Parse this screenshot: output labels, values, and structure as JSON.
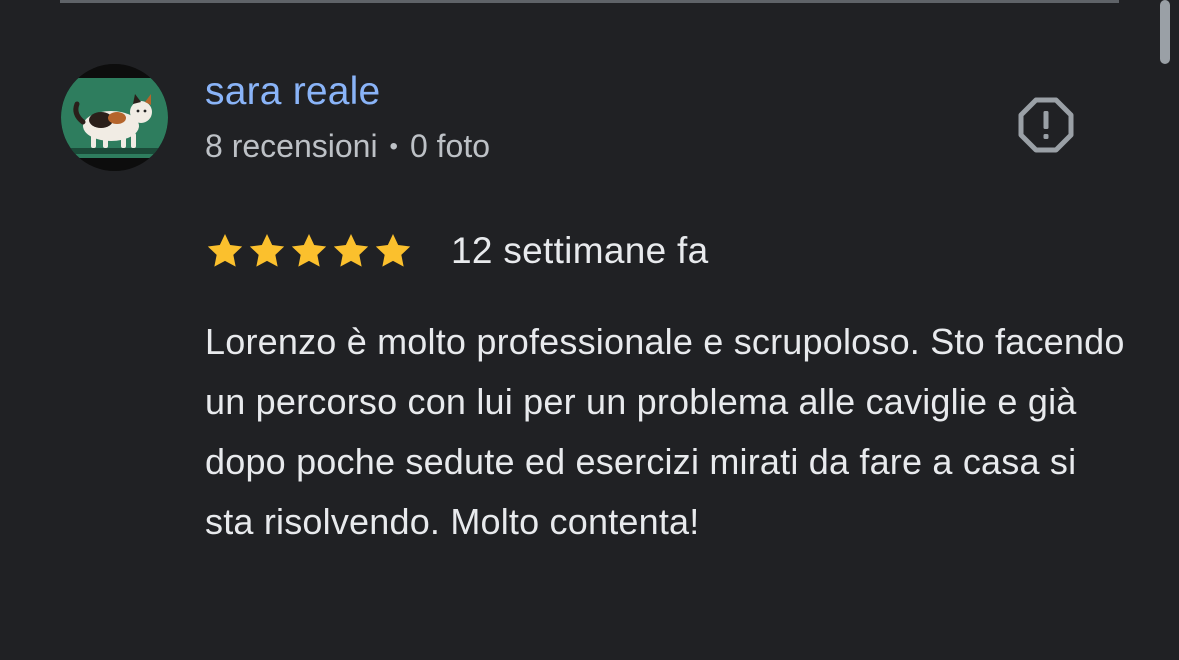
{
  "review": {
    "author": {
      "name": "sara reale",
      "reviews_count": "8 recensioni",
      "separator": "•",
      "photos_count": "0 foto",
      "avatar_icon": "cat-photo-avatar"
    },
    "rating": {
      "stars": 5,
      "max": 5,
      "star_color": "#fbc02d"
    },
    "date": "12 settimane fa",
    "text": "Lorenzo è molto professionale e scrupoloso. Sto facendo un percorso con lui per un problema alle caviglie e già dopo poche sedute ed esercizi mirati da fare a casa si sta risolvendo. Molto contenta!",
    "report_icon": "report-octagon-icon"
  },
  "colors": {
    "background": "#202124",
    "author_name": "#8ab4f8",
    "meta_text": "#bdc1c6",
    "body_text": "#e8eaed"
  }
}
